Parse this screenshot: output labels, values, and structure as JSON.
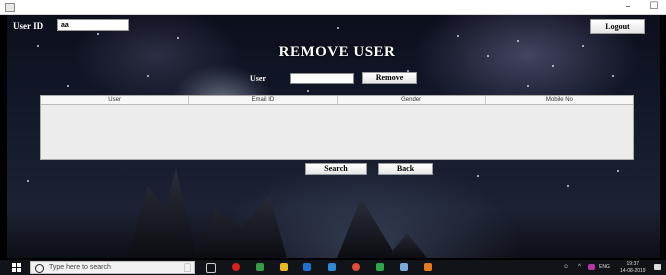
{
  "window": {
    "minimize_glyph": "–",
    "maximize_glyph": "☐"
  },
  "form": {
    "user_id_label": "User ID",
    "user_id_value": "aa",
    "logout_label": "Logout",
    "title": "REMOVE USER",
    "user_label": "User",
    "user_value": "",
    "remove_label": "Remove",
    "search_label": "Search",
    "back_label": "Back"
  },
  "table": {
    "headers": [
      "User",
      "Email ID",
      "Gender",
      "Mobile No"
    ],
    "rows": []
  },
  "taskbar": {
    "search_placeholder": "Type here to search",
    "language": "ENG",
    "time": "19:37",
    "date": "14-08-2019"
  },
  "colors": {
    "taskbar": "#101418",
    "button_face": "#f0f0f0"
  }
}
